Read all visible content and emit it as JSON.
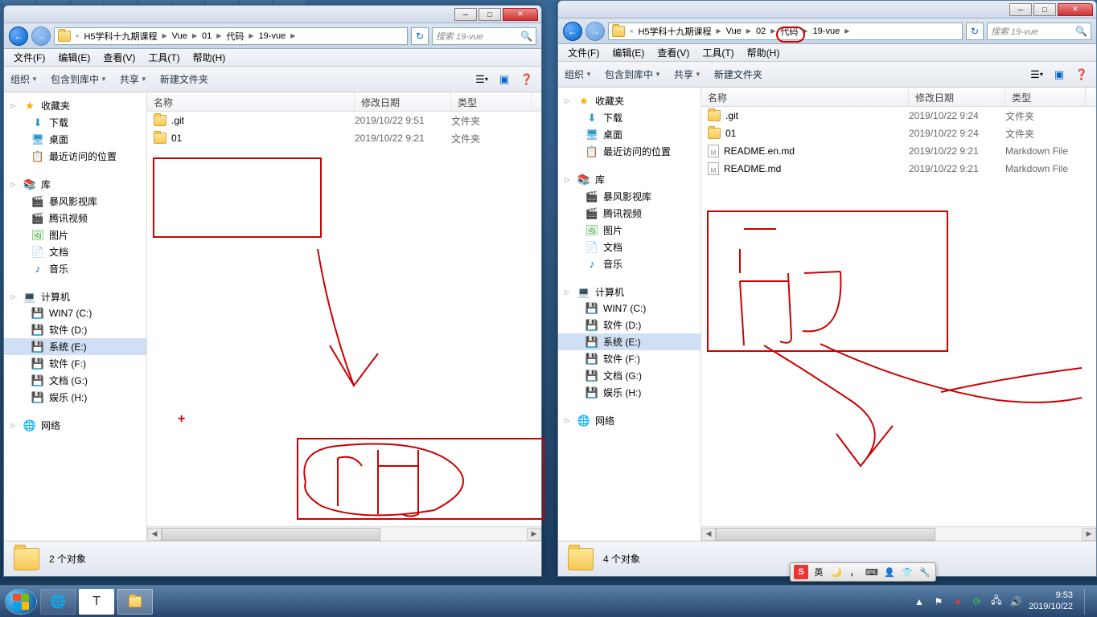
{
  "windows": [
    {
      "breadcrumb": [
        "H5学科十九期课程",
        "Vue",
        "01",
        "代码",
        "19-vue"
      ],
      "search_placeholder": "搜索 19-vue",
      "status": "2 个对象",
      "files": [
        {
          "name": ".git",
          "date": "2019/10/22 9:51",
          "type": "文件夹",
          "icon": "folder"
        },
        {
          "name": "01",
          "date": "2019/10/22 9:21",
          "type": "文件夹",
          "icon": "folder"
        }
      ]
    },
    {
      "breadcrumb": [
        "H5学科十九期课程",
        "Vue",
        "02",
        "代码",
        "19-vue"
      ],
      "search_placeholder": "搜索 19-vue",
      "status": "4 个对象",
      "files": [
        {
          "name": ".git",
          "date": "2019/10/22 9:24",
          "type": "文件夹",
          "icon": "folder"
        },
        {
          "name": "01",
          "date": "2019/10/22 9:24",
          "type": "文件夹",
          "icon": "folder"
        },
        {
          "name": "README.en.md",
          "date": "2019/10/22 9:21",
          "type": "Markdown File",
          "icon": "file"
        },
        {
          "name": "README.md",
          "date": "2019/10/22 9:21",
          "type": "Markdown File",
          "icon": "file"
        }
      ]
    }
  ],
  "menubar": [
    "文件(F)",
    "编辑(E)",
    "查看(V)",
    "工具(T)",
    "帮助(H)"
  ],
  "toolbar": {
    "organize": "组织",
    "include": "包含到库中",
    "share": "共享",
    "newfolder": "新建文件夹"
  },
  "columns": {
    "name": "名称",
    "date": "修改日期",
    "type": "类型"
  },
  "sidebar": {
    "favorites": {
      "label": "收藏夹",
      "items": [
        {
          "l": "下载",
          "i": "dl"
        },
        {
          "l": "桌面",
          "i": "desk"
        },
        {
          "l": "最近访问的位置",
          "i": "recent"
        }
      ]
    },
    "libraries": {
      "label": "库",
      "items": [
        {
          "l": "暴风影视库",
          "i": "vid"
        },
        {
          "l": "腾讯视频",
          "i": "vid"
        },
        {
          "l": "图片",
          "i": "pic"
        },
        {
          "l": "文档",
          "i": "doc"
        },
        {
          "l": "音乐",
          "i": "mus"
        }
      ]
    },
    "computer": {
      "label": "计算机",
      "items": [
        {
          "l": "WIN7 (C:)",
          "i": "win"
        },
        {
          "l": "软件 (D:)",
          "i": "drv"
        },
        {
          "l": "系统 (E:)",
          "i": "drv",
          "sel": true
        },
        {
          "l": "软件 (F:)",
          "i": "drv"
        },
        {
          "l": "文档 (G:)",
          "i": "drv"
        },
        {
          "l": "娱乐 (H:)",
          "i": "drv"
        }
      ]
    },
    "network": {
      "label": "网络"
    }
  },
  "ime": {
    "logo": "S",
    "lang": "英"
  },
  "clock": {
    "time": "9:53",
    "date": "2019/10/22"
  }
}
